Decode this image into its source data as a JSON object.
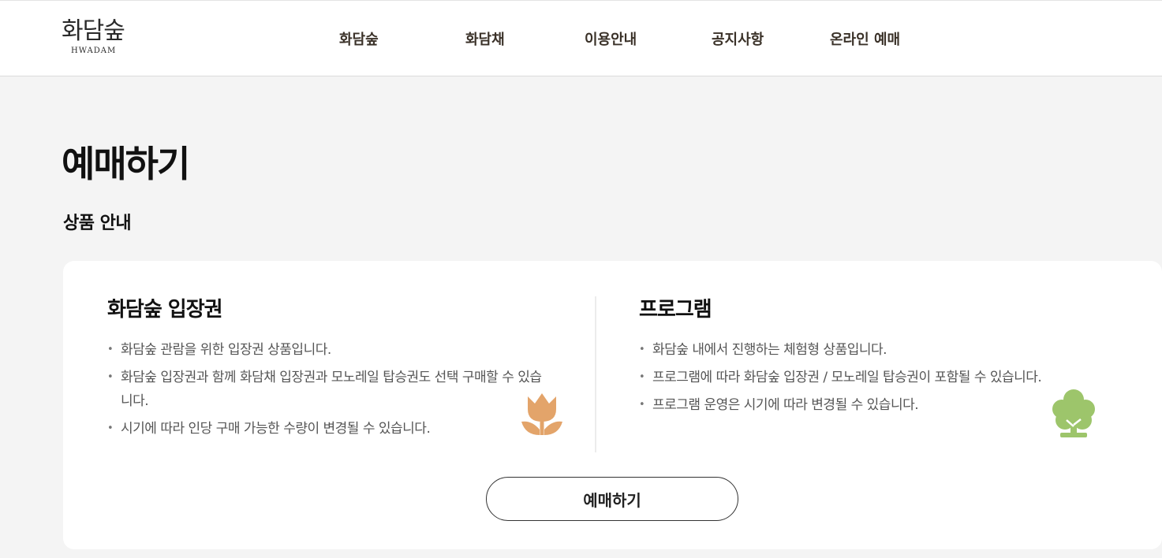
{
  "header": {
    "logo": {
      "korean": "화담숲",
      "english": "HWADAM"
    },
    "nav": [
      {
        "label": "화담숲"
      },
      {
        "label": "화담채"
      },
      {
        "label": "이용안내"
      },
      {
        "label": "공지사항"
      },
      {
        "label": "온라인 예매"
      }
    ]
  },
  "main": {
    "page_title": "예매하기",
    "section_title": "상품 안내",
    "products": [
      {
        "title": "화담숲 입장권",
        "icon": "tulip-icon",
        "icon_color": "#e3a46a",
        "bullets": [
          "화담숲 관람을 위한 입장권 상품입니다.",
          "화담숲 입장권과 함께 화담채 입장권과 모노레일 탑승권도 선택 구매할 수 있습니다.",
          "시기에 따라 인당 구매 가능한 수량이 변경될 수 있습니다."
        ]
      },
      {
        "title": "프로그램",
        "icon": "tree-icon",
        "icon_color": "#9dc56b",
        "bullets": [
          "화담숲 내에서 진행하는 체험형 상품입니다.",
          "프로그램에 따라 화담숲 입장권 / 모노레일 탑승권이 포함될 수 있습니다.",
          "프로그램 운영은 시기에 따라 변경될 수 있습니다."
        ]
      }
    ],
    "book_button": "예매하기"
  }
}
